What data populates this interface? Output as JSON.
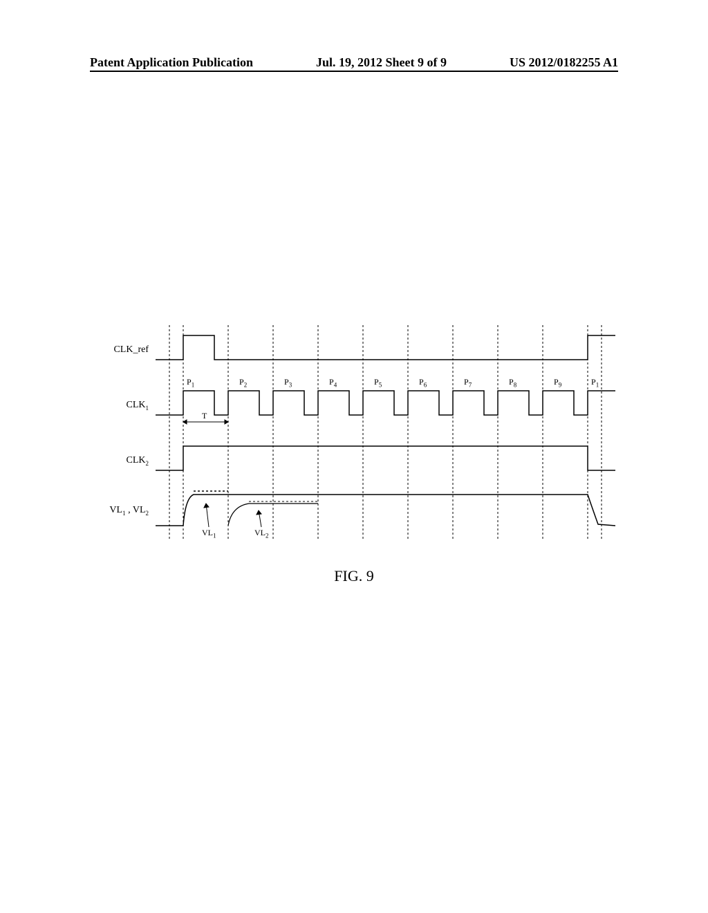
{
  "header": {
    "left": "Patent Application Publication",
    "center": "Jul. 19, 2012  Sheet 9 of 9",
    "right": "US 2012/0182255 A1"
  },
  "signals": {
    "clk_ref": "CLK_ref",
    "clk1": "CLK",
    "clk1_sub": "1",
    "clk2": "CLK",
    "clk2_sub": "2",
    "vl": "VL",
    "vl1_sub": "1",
    "vl2_sub": "2"
  },
  "periods": {
    "p1": "P",
    "p2": "P",
    "p3": "P",
    "p4": "P",
    "p5": "P",
    "p6": "P",
    "p7": "P",
    "p8": "P",
    "p9": "P",
    "p1_end": "P"
  },
  "period_subs": {
    "s1": "1",
    "s2": "2",
    "s3": "3",
    "s4": "4",
    "s5": "5",
    "s6": "6",
    "s7": "7",
    "s8": "8",
    "s9": "9"
  },
  "t_label": "T",
  "vl1_label": "VL",
  "vl1_label_sub": "1",
  "vl2_label": "VL",
  "vl2_label_sub": "2",
  "figure_caption": "FIG.  9"
}
